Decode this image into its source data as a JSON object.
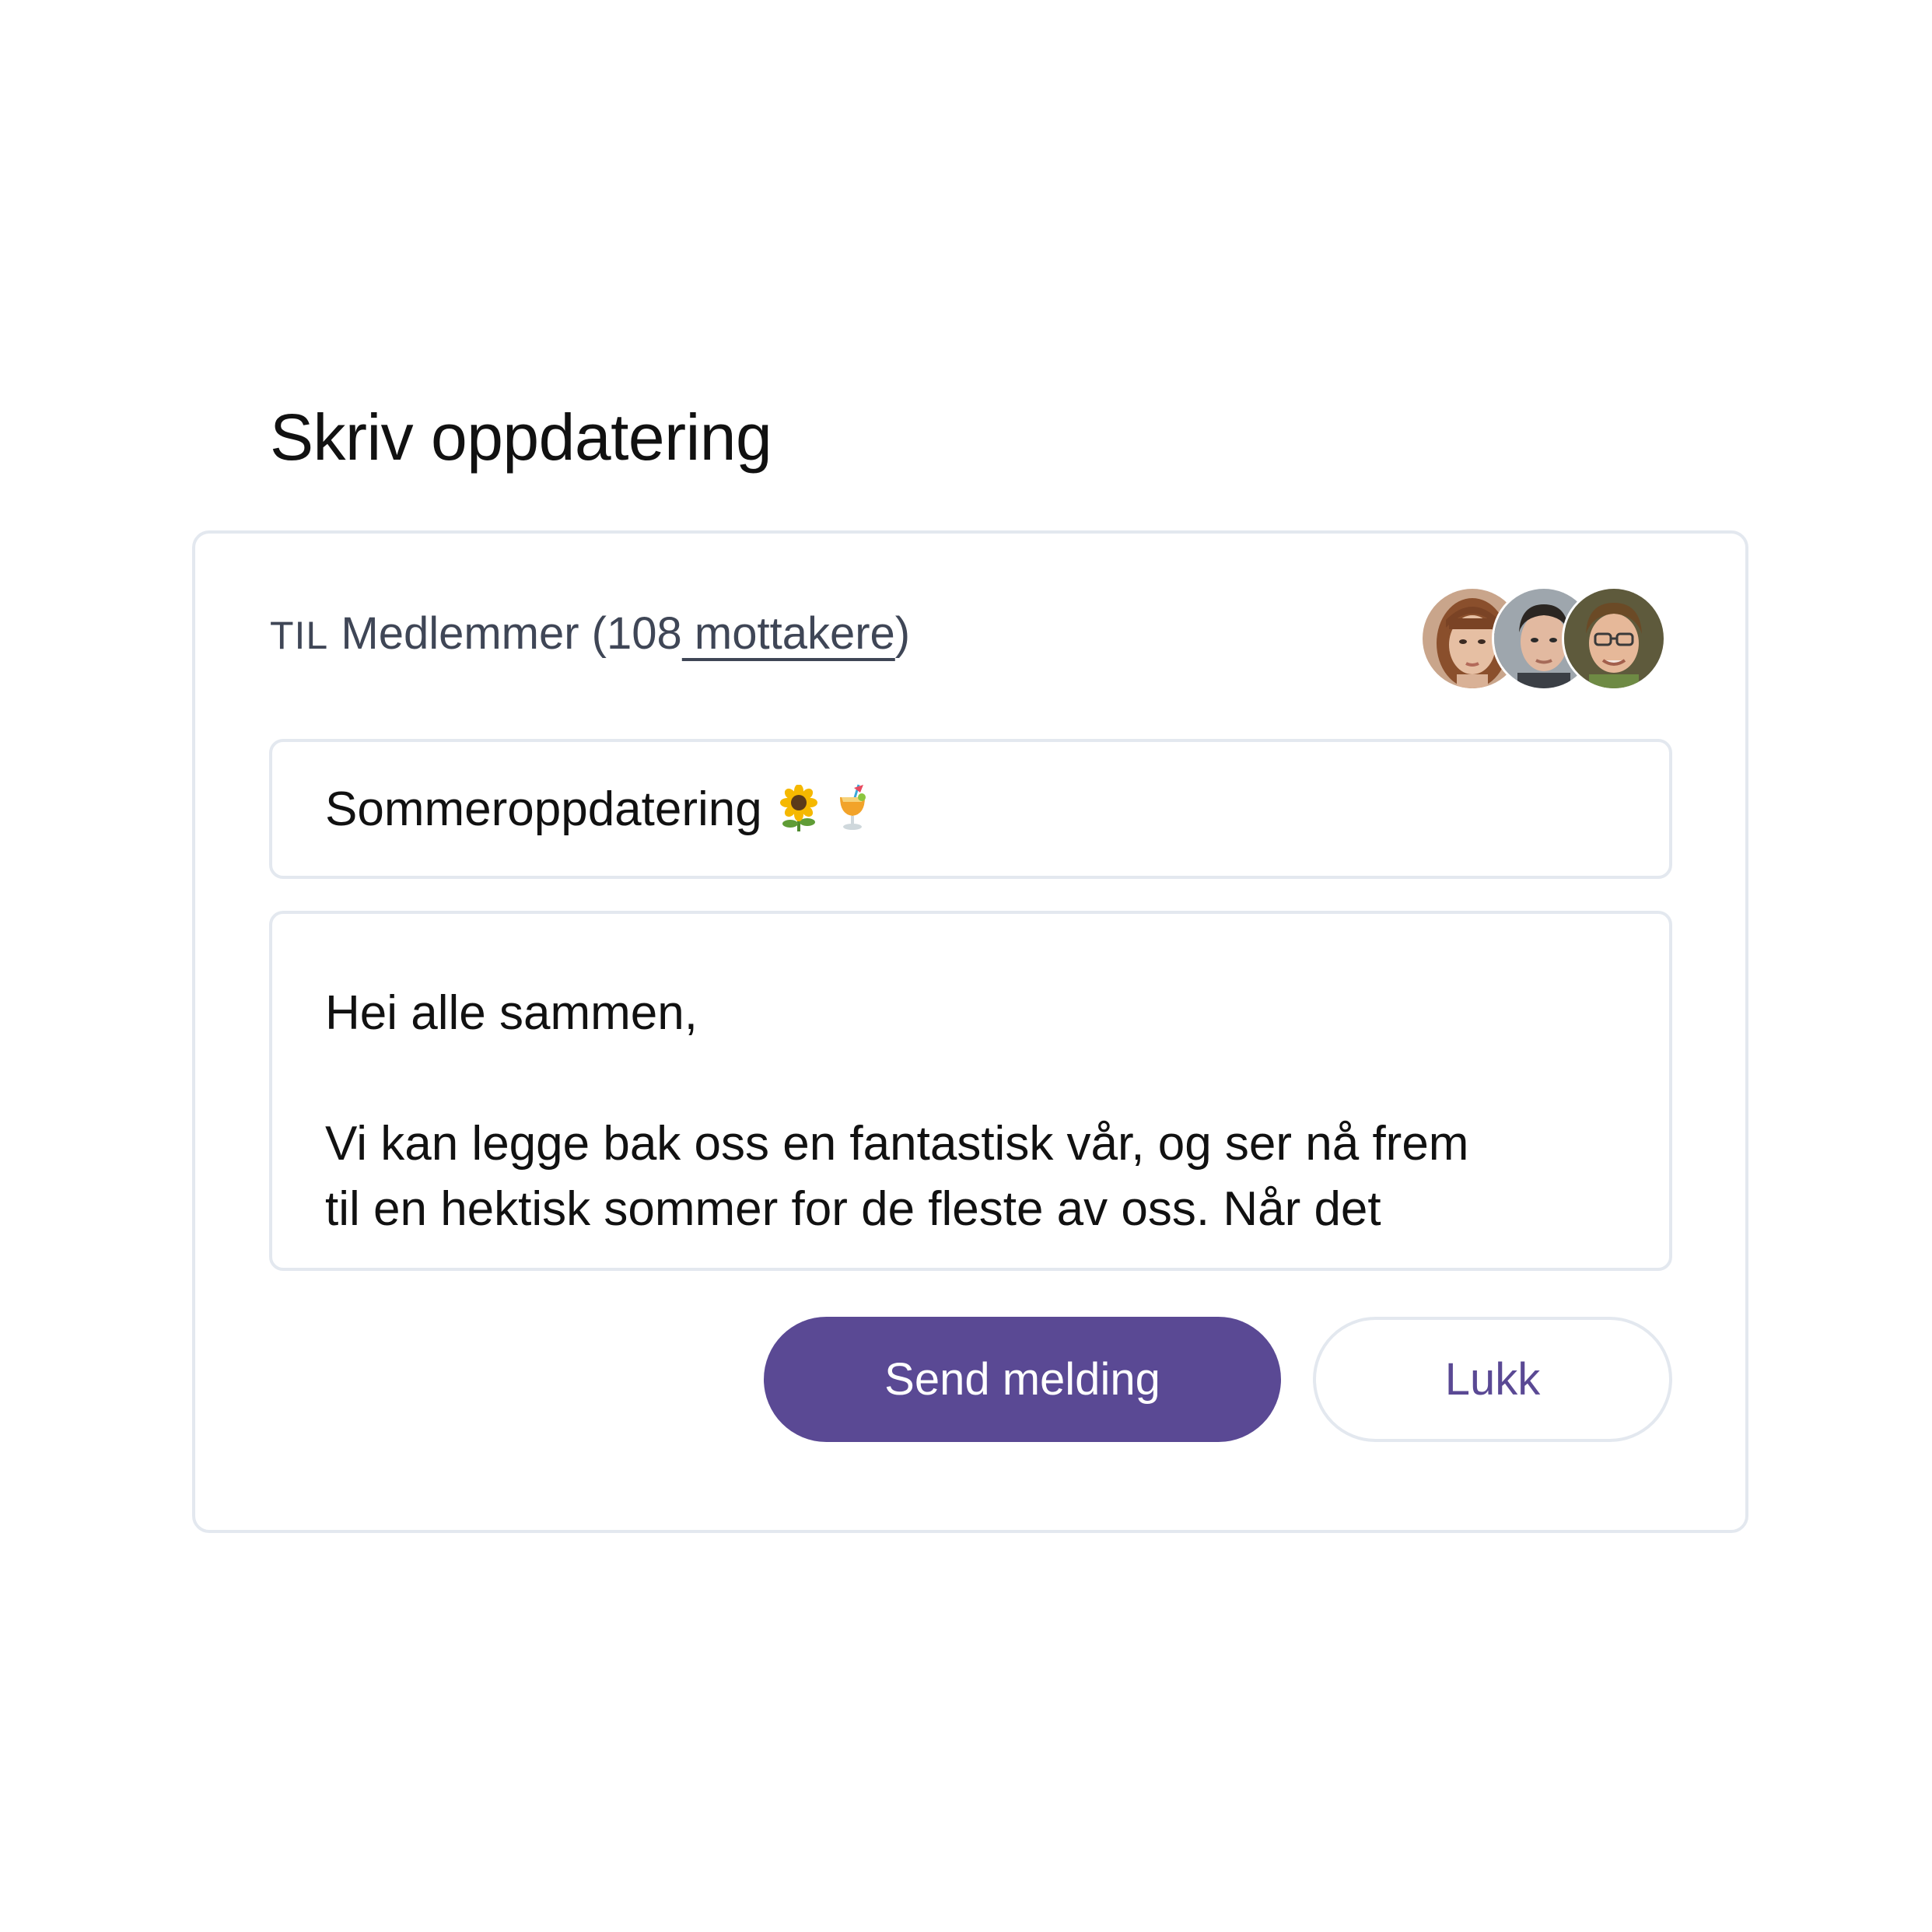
{
  "page": {
    "title": "Skriv oppdatering"
  },
  "recipients": {
    "prefix": "TIL",
    "group": "Medlemmer",
    "open_paren": "(",
    "count": "108",
    "link_label": " mottakere",
    "close_paren": ")"
  },
  "avatars": [
    {
      "name": "avatar-woman",
      "icon": "person-photo"
    },
    {
      "name": "avatar-man",
      "icon": "person-photo"
    },
    {
      "name": "avatar-man-glasses",
      "icon": "person-photo"
    }
  ],
  "subject": {
    "value": "Sommeroppdatering",
    "emojis": [
      "sunflower-emoji",
      "tropical-drink-emoji"
    ]
  },
  "message": {
    "lines": [
      "Hei alle sammen,",
      "Vi kan legge bak oss en fantastisk vår, og ser nå frem",
      "til en hektisk sommer for de fleste av oss. Når det"
    ]
  },
  "actions": {
    "send_label": "Send melding",
    "close_label": "Lukk"
  },
  "colors": {
    "accent": "#5a4994",
    "border": "#e3e8ef",
    "muted_text": "#3f4656"
  }
}
